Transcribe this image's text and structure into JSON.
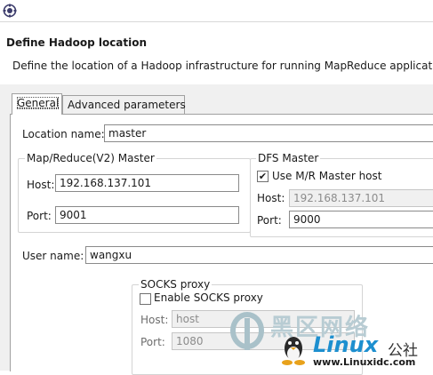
{
  "dialog": {
    "title": "Define Hadoop location",
    "description": "Define the location of a Hadoop infrastructure for running MapReduce applicatio"
  },
  "tabs": [
    {
      "label": "General",
      "active": true
    },
    {
      "label": "Advanced parameters",
      "active": false
    }
  ],
  "general": {
    "location_name_label": "Location name:",
    "location_name_value": "master",
    "mr_master": {
      "title": "Map/Reduce(V2) Master",
      "host_label": "Host:",
      "host_value": "192.168.137.101",
      "port_label": "Port:",
      "port_value": "9001"
    },
    "dfs_master": {
      "title": "DFS Master",
      "use_mr_host_label": "Use M/R Master host",
      "use_mr_host_checked": true,
      "host_label": "Host:",
      "host_value": "192.168.137.101",
      "port_label": "Port:",
      "port_value": "9000"
    },
    "user_name_label": "User name:",
    "user_name_value": "wangxu",
    "socks": {
      "title": "SOCKS proxy",
      "enable_label": "Enable SOCKS proxy",
      "enable_checked": false,
      "host_label": "Host:",
      "host_value": "host",
      "port_label": "Port:",
      "port_value": "1080"
    }
  },
  "watermark": {
    "brand_cn": "黑区网络",
    "brand_en": "Linux",
    "suffix_cn": "公社",
    "url": "www.Linuxidc.com"
  },
  "colors": {
    "dialog_background": "#f0f0f0",
    "field_border": "#8a8a8a",
    "disabled_text": "#8c8c8c"
  }
}
